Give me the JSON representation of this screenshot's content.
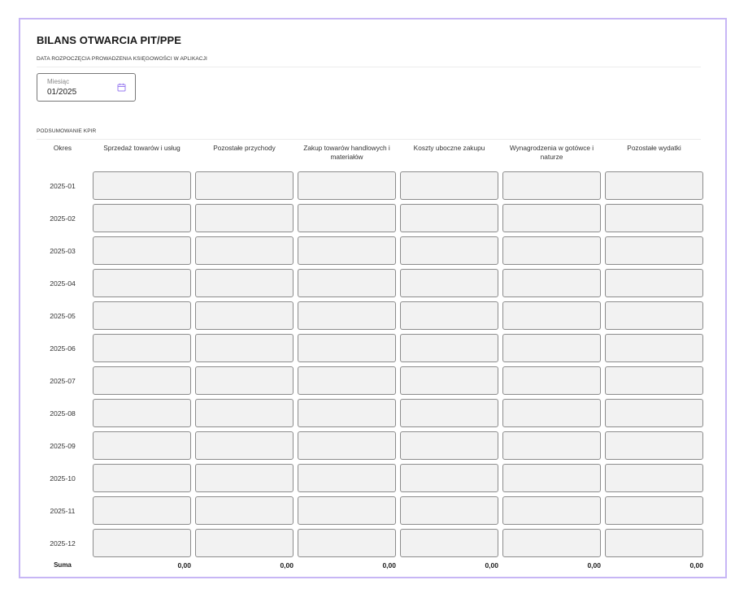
{
  "header": {
    "title": "BILANS OTWARCIA PIT/PPE",
    "start_date_label": "DATA ROZPOCZĘCIA PROWADZENIA KSIĘGOWOŚCI W APLIKACJI"
  },
  "month_field": {
    "label": "Miesiąc",
    "value": "01/2025",
    "icon": "calendar-icon"
  },
  "summary": {
    "section_label": "PODSUMOWANIE KPIR",
    "columns": [
      "Okres",
      "Sprzedaż towarów i usług",
      "Pozostałe przychody",
      "Zakup towarów handlowych i materiałów",
      "Koszty uboczne zakupu",
      "Wynagrodzenia w gotówce i naturze",
      "Pozostałe wydatki"
    ],
    "periods": [
      "2025-01",
      "2025-02",
      "2025-03",
      "2025-04",
      "2025-05",
      "2025-06",
      "2025-07",
      "2025-08",
      "2025-09",
      "2025-10",
      "2025-11",
      "2025-12"
    ],
    "sum_label": "Suma",
    "sums": [
      "0,00",
      "0,00",
      "0,00",
      "0,00",
      "0,00",
      "0,00"
    ]
  },
  "colors": {
    "frame_border": "#c7b6f5",
    "input_fill": "#f2f2f2",
    "input_border": "#8c8c8c"
  }
}
